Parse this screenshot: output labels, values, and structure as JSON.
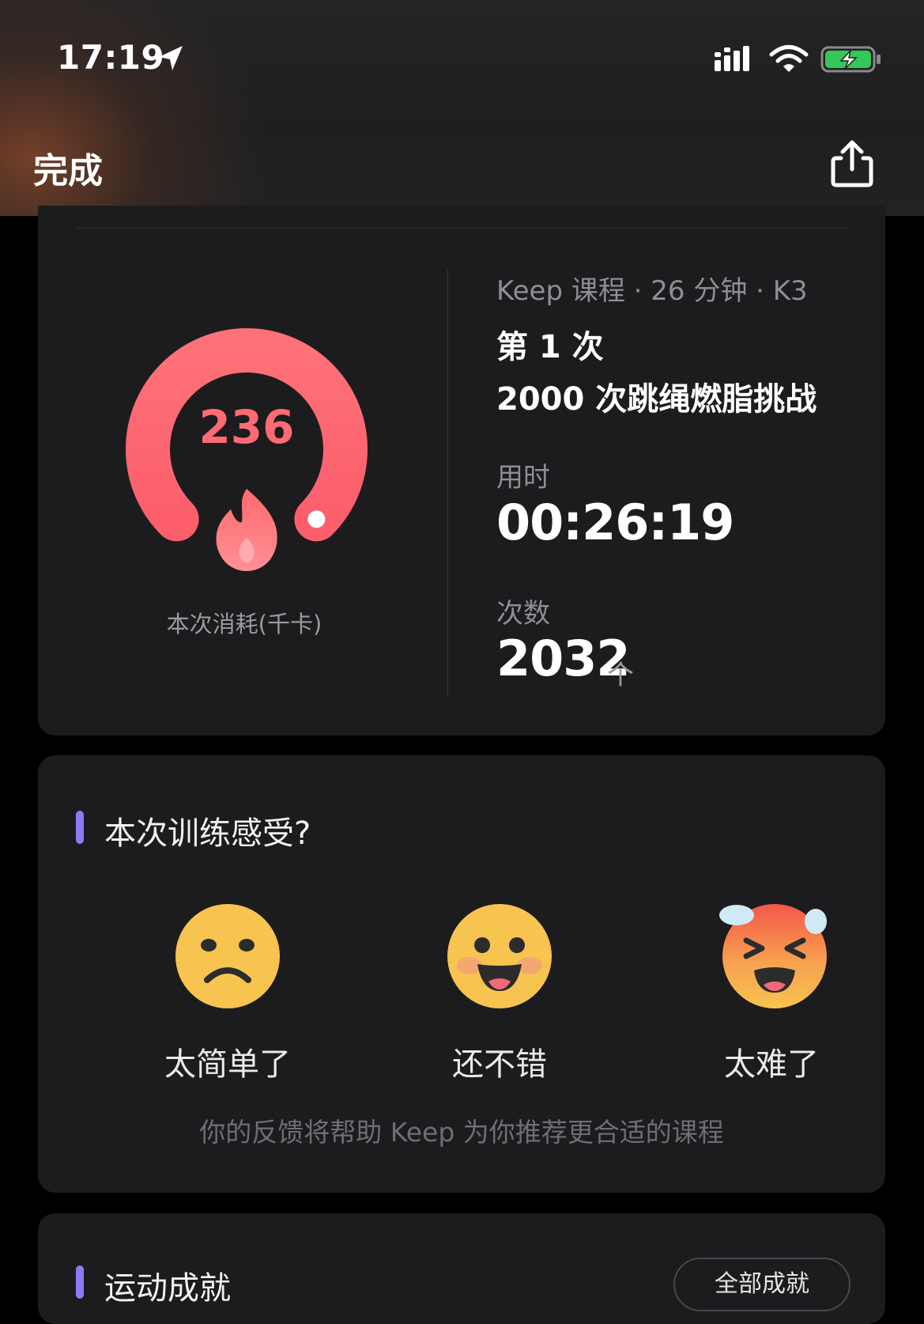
{
  "status_bar": {
    "time": "17:19"
  },
  "nav": {
    "done_label": "完成",
    "share_icon": "share-icon"
  },
  "summary": {
    "calories": "236",
    "calories_label": "本次消耗(千卡)",
    "meta": "Keep 课程 · 26 分钟 · K3",
    "attempt": "第 1 次",
    "course_title": "2000 次跳绳燃脂挑战",
    "duration_label": "用时",
    "duration": "00:26:19",
    "count_label": "次数",
    "count": "2032",
    "count_unit": "个"
  },
  "feedback": {
    "title": "本次训练感受?",
    "options": [
      {
        "label": "太简单了",
        "icon": "sad-face-icon"
      },
      {
        "label": "还不错",
        "icon": "happy-face-icon"
      },
      {
        "label": "太难了",
        "icon": "exhausted-face-icon"
      }
    ],
    "hint": "你的反馈将帮助 Keep 为你推荐更合适的课程"
  },
  "achievements": {
    "title": "运动成就",
    "all_button": "全部成就"
  },
  "colors": {
    "gauge": "#ff5f6d",
    "accent_bar": "#8b7cf6",
    "card": "#1c1c1e"
  }
}
